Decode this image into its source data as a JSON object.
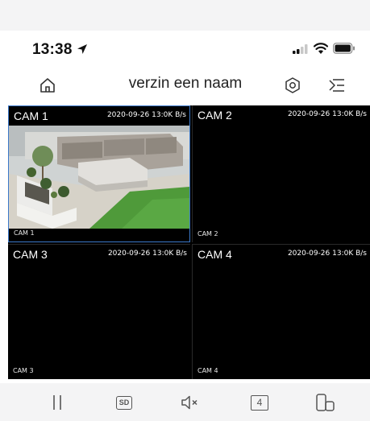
{
  "status_bar": {
    "time": "13:38",
    "location_icon": "location-arrow-icon",
    "signal_icon": "cellular-signal-icon",
    "wifi_icon": "wifi-icon",
    "battery_icon": "battery-icon"
  },
  "nav": {
    "title": "verzin een naam",
    "home_icon": "home-icon",
    "settings_icon": "settings-icon",
    "menu_icon": "menu-icon"
  },
  "cameras": [
    {
      "name": "CAM 1",
      "overlay": "2020-09-26 13:0K B/s",
      "osd": "CAM 1",
      "selected": true,
      "has_image": true
    },
    {
      "name": "CAM 2",
      "overlay": "2020-09-26 13:0K B/s",
      "osd": "CAM 2",
      "selected": false,
      "has_image": false
    },
    {
      "name": "CAM 3",
      "overlay": "2020-09-26 13:0K B/s",
      "osd": "CAM 3",
      "selected": false,
      "has_image": false
    },
    {
      "name": "CAM 4",
      "overlay": "2020-09-26 13:0K B/s",
      "osd": "CAM 4",
      "selected": false,
      "has_image": false
    }
  ],
  "toolbar": {
    "sd_label": "SD",
    "split_label": "4",
    "pause_icon": "pause-icon",
    "sd_icon": "sd-quality-icon",
    "mute_icon": "speaker-muted-icon",
    "split_icon": "split-screen-icon",
    "rotate_icon": "phone-rotate-icon"
  },
  "colors": {
    "selected_border": "#3b78c9",
    "video_background": "#000000",
    "bar_background": "#f4f4f5"
  }
}
